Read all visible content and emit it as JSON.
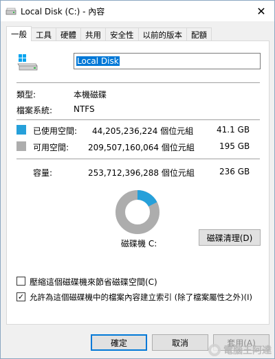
{
  "window": {
    "title": "Local Disk (C:) - 內容",
    "close_glyph": "✕"
  },
  "tabs": [
    {
      "label": "一般",
      "active": true
    },
    {
      "label": "工具",
      "active": false
    },
    {
      "label": "硬體",
      "active": false
    },
    {
      "label": "共用",
      "active": false
    },
    {
      "label": "安全性",
      "active": false
    },
    {
      "label": "以前的版本",
      "active": false
    },
    {
      "label": "配額",
      "active": false
    }
  ],
  "drive": {
    "icon": "drive-icon",
    "name": "Local Disk"
  },
  "info": {
    "type_label": "類型:",
    "type_value": "本機磁碟",
    "fs_label": "檔案系統:",
    "fs_value": "NTFS"
  },
  "usage": {
    "used_label": "已使用空間:",
    "used_bytes": "44,205,236,224 個位元組",
    "used_size": "41.1 GB",
    "free_label": "可用空間:",
    "free_bytes": "209,507,160,064 個位元組",
    "free_size": "195 GB",
    "capacity_label": "容量:",
    "capacity_bytes": "253,712,396,288 個位元組",
    "capacity_size": "236 GB",
    "used_fraction": 0.174,
    "used_color": "#26a0da",
    "free_color": "#adadad"
  },
  "drive_label": "磁碟機 C:",
  "cleanup_button": "磁碟清理(D)",
  "options": {
    "compress_label": "壓縮這個磁碟機來節省磁碟空間(C)",
    "compress_checked": false,
    "index_label": "允許為這個磁碟機中的檔案內容建立索引 (除了檔案屬性之外)(I)",
    "index_checked": true
  },
  "footer": {
    "ok": "確定",
    "cancel": "取消",
    "apply": "套用(A)"
  },
  "watermark": {
    "text": "電腦王阿達"
  }
}
